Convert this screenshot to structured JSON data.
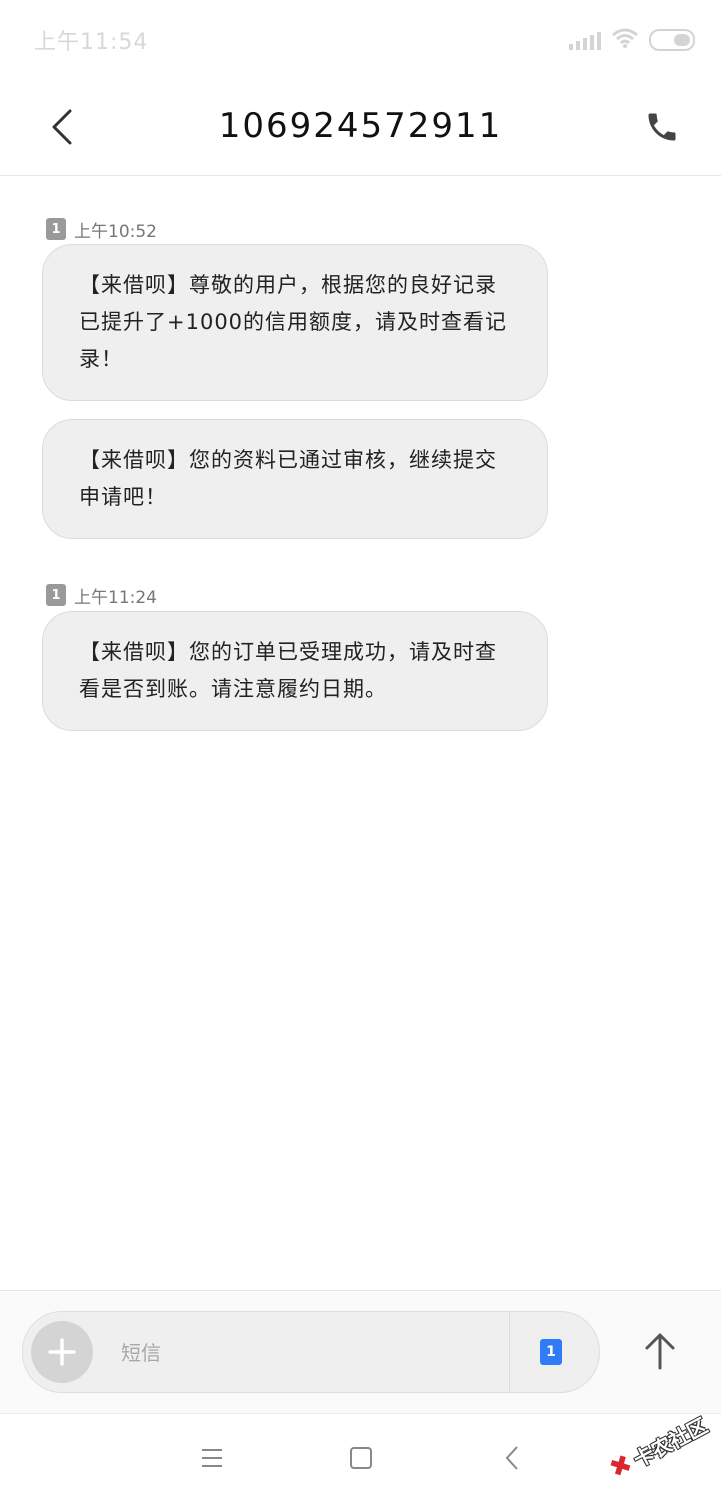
{
  "status_bar": {
    "time": "上午11:54",
    "icons": [
      "signal-icon",
      "wifi-icon",
      "battery-icon"
    ]
  },
  "header": {
    "back_icon": "chevron-left-icon",
    "title": "106924572911",
    "call_icon": "phone-icon"
  },
  "messages": [
    {
      "sim": "1",
      "time": "上午10:52",
      "bubbles": [
        "【来借呗】尊敬的用户，根据您的良好记录已提升了+1000的信用额度，请及时查看记录！",
        "【来借呗】您的资料已通过审核，继续提交申请吧！"
      ]
    },
    {
      "sim": "1",
      "time": "上午11:24",
      "bubbles": [
        "【来借呗】您的订单已受理成功，请及时查看是否到账。请注意履约日期。"
      ]
    }
  ],
  "composer": {
    "add_icon": "plus-icon",
    "placeholder": "短信",
    "sim_label": "1",
    "send_icon": "arrow-up-icon"
  },
  "nav_bar": {
    "icons": [
      "menu-icon",
      "home-square-icon",
      "back-triangle-icon"
    ]
  },
  "watermark": {
    "text": "卡农社区"
  },
  "colors": {
    "bubble_bg": "#efefef",
    "sim_badge": "#9a9a9a",
    "sim_select": "#2f7cf6",
    "watermark_mark": "#d9272c"
  }
}
